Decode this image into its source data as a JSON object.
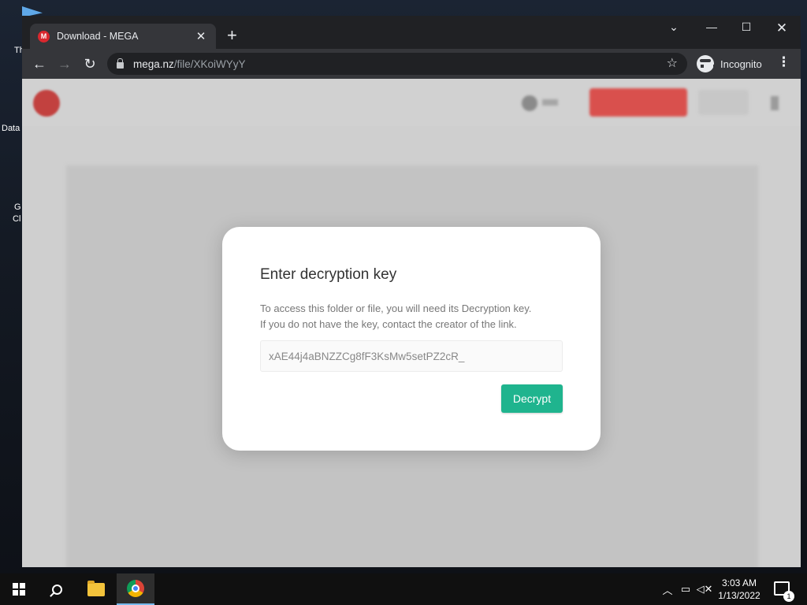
{
  "desktop": {
    "icons": [
      {
        "label": "Th"
      },
      {
        "label": "Data"
      },
      {
        "label": "G"
      },
      {
        "label": "Cl"
      }
    ]
  },
  "browser": {
    "tab": {
      "title": "Download - MEGA",
      "favicon": "M"
    },
    "url": {
      "host": "mega.nz",
      "path": "/file/XKoiWYyY"
    },
    "profile_label": "Incognito"
  },
  "dialog": {
    "title": "Enter decryption key",
    "description_line1": "To access this folder or file, you will need its Decryption key.",
    "description_line2": "If you do not have the key, contact the creator of the link.",
    "key_value": "xAE44j4aBNZZCg8fF3KsMw5setPZ2cR_",
    "decrypt_label": "Decrypt",
    "accent_color": "#1fb48e"
  },
  "taskbar": {
    "time": "3:03 AM",
    "date": "1/13/2022",
    "notification_count": "1"
  }
}
